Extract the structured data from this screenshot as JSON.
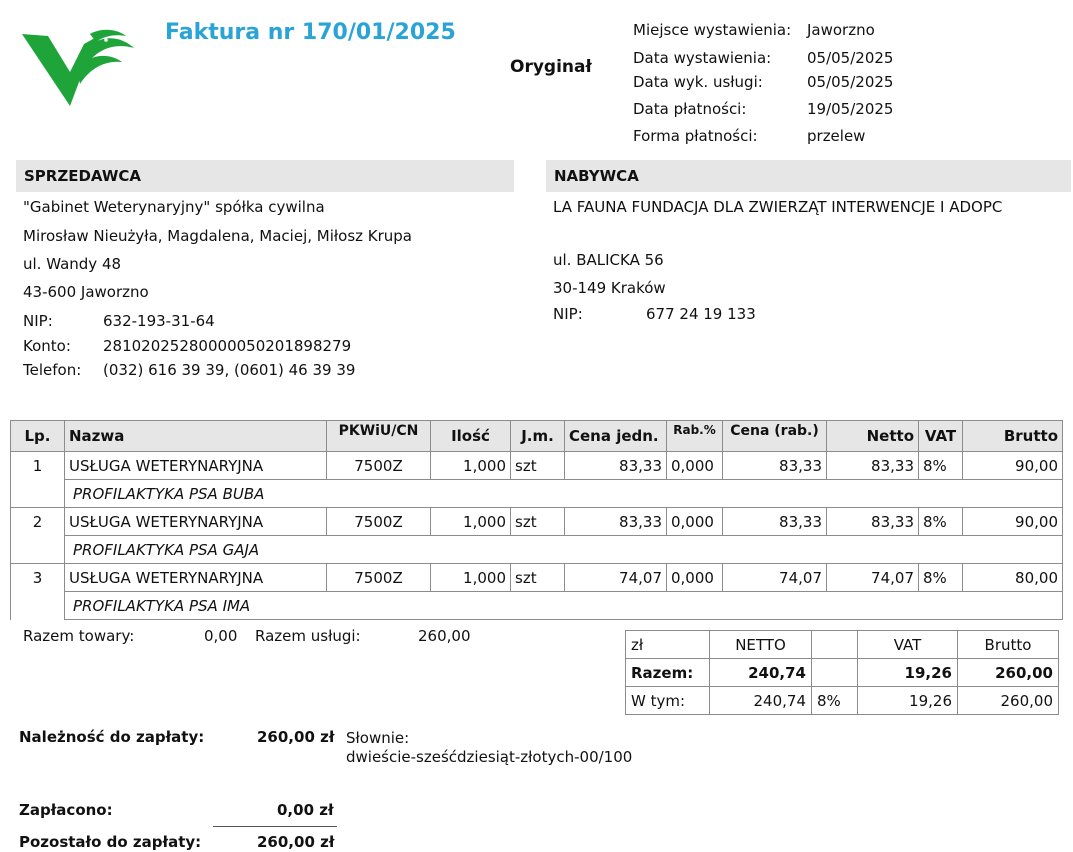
{
  "invoice": {
    "title": "Faktura nr 170/01/2025",
    "original_label": "Oryginał",
    "meta": [
      {
        "label": "Miejsce wystawienia:",
        "value": "Jaworzno"
      },
      {
        "label": "Data wystawienia:",
        "value": "05/05/2025"
      },
      {
        "label": "Data wyk. usługi:",
        "value": "05/05/2025"
      },
      {
        "label": "Data płatności:",
        "value": "19/05/2025"
      },
      {
        "label": "Forma płatności:",
        "value": "przelew"
      }
    ]
  },
  "seller": {
    "heading": "SPRZEDAWCA",
    "name": "\"Gabinet Weterynaryjny\" spółka cywilna",
    "owners": "Mirosław Nieużyła, Magdalena, Maciej, Miłosz Krupa",
    "street": "ul. Wandy 48",
    "city": "43-600 Jaworzno",
    "nip_label": "NIP:",
    "nip": "632-193-31-64",
    "account_label": "Konto:",
    "account": "28102025280000050201898279",
    "phone_label": "Telefon:",
    "phone": "(032) 616 39 39, (0601) 46 39 39"
  },
  "buyer": {
    "heading": "NABYWCA",
    "name": "LA FAUNA FUNDACJA DLA ZWIERZĄT INTERWENCJE I ADOPC",
    "street": "ul. BALICKA 56",
    "city": "30-149 Kraków",
    "nip_label": "NIP:",
    "nip": "677 24 19 133"
  },
  "items_table": {
    "headers": [
      "Lp.",
      "Nazwa",
      "PKWiU/CN",
      "Ilość",
      "J.m.",
      "Cena jedn.",
      "Rab.%",
      "Cena (rab.)",
      "Netto",
      "VAT",
      "Brutto"
    ],
    "rows": [
      {
        "lp": "1",
        "name": "USŁUGA WETERYNARYJNA",
        "pkwiu": "7500Z",
        "qty": "1,000",
        "unit": "szt",
        "price": "83,33",
        "disc": "0,000",
        "price_disc": "83,33",
        "net": "83,33",
        "vat": "8%",
        "gross": "90,00",
        "desc": "PROFILAKTYKA PSA BUBA"
      },
      {
        "lp": "2",
        "name": "USŁUGA WETERYNARYJNA",
        "pkwiu": "7500Z",
        "qty": "1,000",
        "unit": "szt",
        "price": "83,33",
        "disc": "0,000",
        "price_disc": "83,33",
        "net": "83,33",
        "vat": "8%",
        "gross": "90,00",
        "desc": "PROFILAKTYKA PSA GAJA"
      },
      {
        "lp": "3",
        "name": "USŁUGA WETERYNARYJNA",
        "pkwiu": "7500Z",
        "qty": "1,000",
        "unit": "szt",
        "price": "74,07",
        "disc": "0,000",
        "price_disc": "74,07",
        "net": "74,07",
        "vat": "8%",
        "gross": "80,00",
        "desc": "PROFILAKTYKA PSA IMA"
      }
    ]
  },
  "totals_left": {
    "goods_label": "Razem towary:",
    "goods_value": "0,00",
    "services_label": "Razem usługi:",
    "services_value": "260,00"
  },
  "summary_table": {
    "currency": "zł",
    "h_net": "NETTO",
    "h_vat": "VAT",
    "h_gross": "Brutto",
    "total_label": "Razem:",
    "total_net": "240,74",
    "total_vat": "19,26",
    "total_gross": "260,00",
    "incl_label": "W tym:",
    "incl_net": "240,74",
    "incl_rate": "8%",
    "incl_vat": "19,26",
    "incl_gross": "260,00"
  },
  "payment": {
    "due_label": "Należność do zapłaty:",
    "due_value": "260,00 zł",
    "words_label": "Słownie:",
    "words_value": "dwieście-sześćdziesiąt-złotych-00/100",
    "paid_label": "Zapłacono:",
    "paid_value": "0,00 zł",
    "remaining_label": "Pozostało do zapłaty:",
    "remaining_value": "260,00 zł"
  },
  "colors": {
    "title": "#2aa3d6",
    "logo": "#1fa43a",
    "header_bg": "#e6e6e6"
  },
  "logo_icon": "green-bird-v-logo"
}
